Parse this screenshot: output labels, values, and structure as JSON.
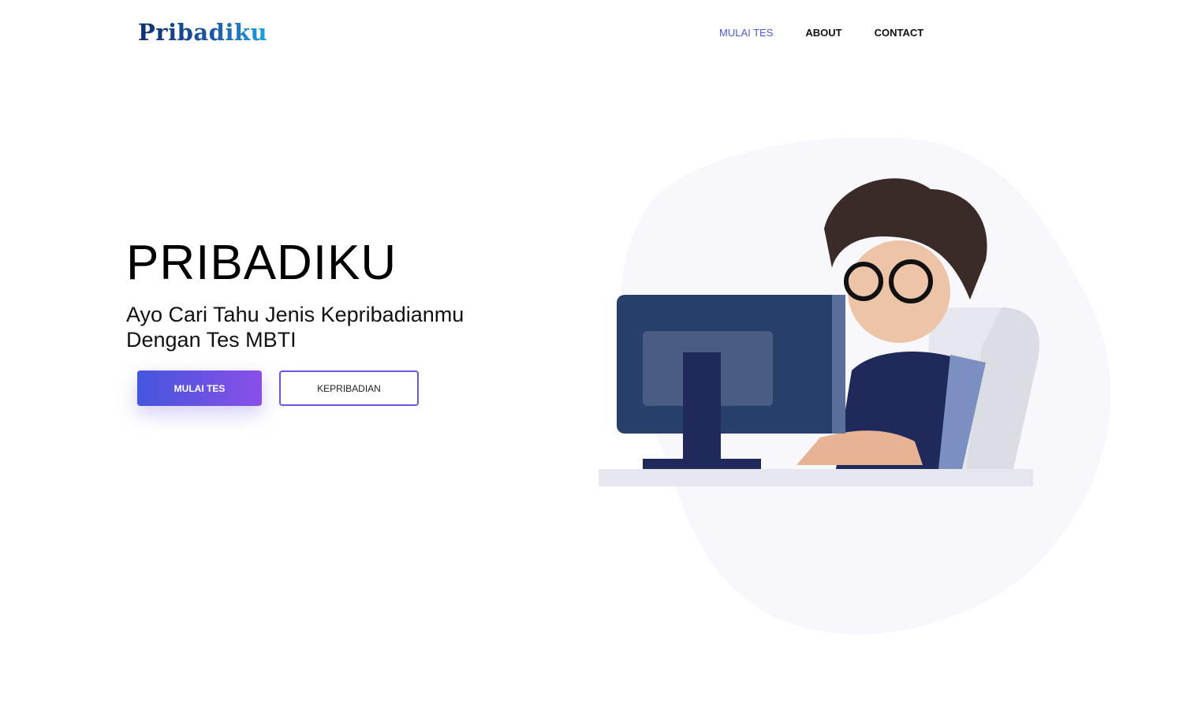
{
  "header": {
    "logo": "Pribadiku",
    "nav": [
      {
        "label": "MULAI TES",
        "active": true
      },
      {
        "label": "ABOUT"
      },
      {
        "label": "CONTACT"
      }
    ]
  },
  "hero": {
    "title": "PRIBADIKU",
    "subtitle": "Ayo Cari Tahu Jenis Kepribadianmu Dengan Tes MBTI",
    "primary_button": "MULAI TES",
    "secondary_button": "KEPRIBADIAN"
  },
  "colors": {
    "accent": "#4b5bd6",
    "gradient_start": "#4356dc",
    "gradient_end": "#8a4fe8"
  }
}
